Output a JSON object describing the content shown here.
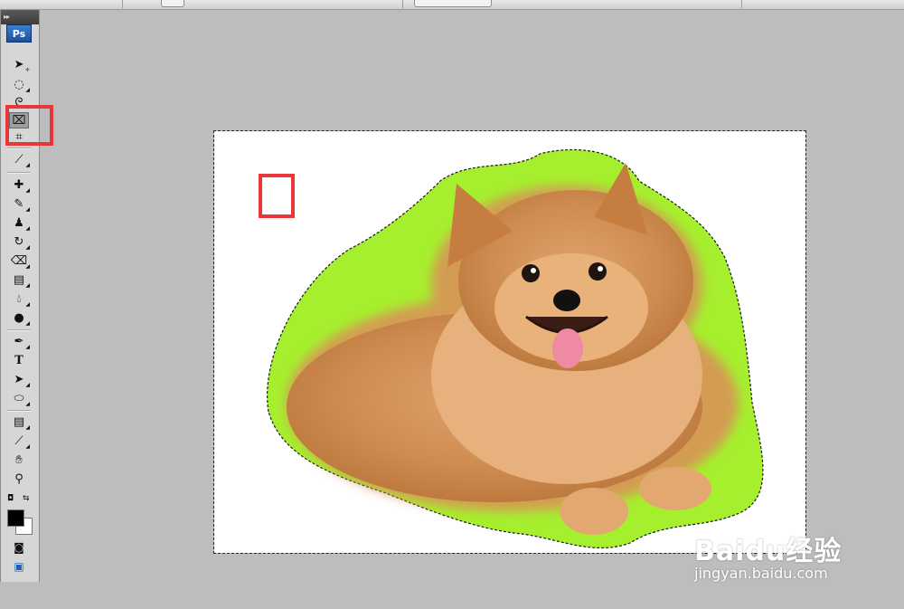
{
  "app": {
    "name": "Photoshop",
    "logo_text": "Ps"
  },
  "tools": [
    {
      "name": "move-tool"
    },
    {
      "name": "marquee-tool"
    },
    {
      "name": "lasso-tool"
    },
    {
      "name": "quick-selection-tool",
      "active": true
    },
    {
      "name": "crop-tool"
    },
    {
      "name": "eyedropper-tool"
    },
    {
      "name": "healing-brush-tool"
    },
    {
      "name": "brush-tool"
    },
    {
      "name": "clone-stamp-tool"
    },
    {
      "name": "history-brush-tool"
    },
    {
      "name": "eraser-tool"
    },
    {
      "name": "gradient-tool"
    },
    {
      "name": "blur-tool"
    },
    {
      "name": "dodge-tool"
    },
    {
      "name": "pen-tool"
    },
    {
      "name": "type-tool",
      "label": "T"
    },
    {
      "name": "path-selection-tool"
    },
    {
      "name": "shape-tool"
    },
    {
      "name": "notes-tool"
    },
    {
      "name": "color-sampler-tool"
    },
    {
      "name": "hand-tool"
    },
    {
      "name": "zoom-tool"
    }
  ],
  "colors": {
    "foreground": "#000000",
    "background": "#ffffff",
    "annotation": "#e8373b",
    "selection_edge": "#9cf026",
    "workspace": "#bdbdbd"
  },
  "watermark": {
    "brand": "Baidu经验",
    "url": "jingyan.baidu.com"
  }
}
